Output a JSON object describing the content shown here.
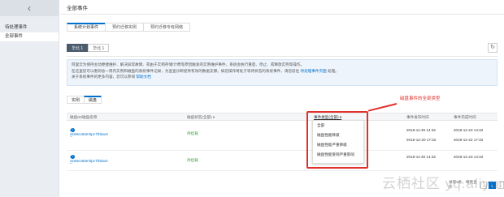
{
  "sidebar": {
    "back_icon": "‹",
    "items": [
      {
        "label": "待处理事件"
      },
      {
        "label": "全部事件"
      }
    ]
  },
  "page": {
    "title": "全部事件"
  },
  "top_tabs": [
    "系统计划事件",
    "预约迁移实例",
    "预约迁移专有网络"
  ],
  "sub_tabs": [
    "华北 1",
    "华北 1"
  ],
  "notice": {
    "line1": "阿里云为保持主动便捷维护、解决异常故障、或由于实例存储/计费等原因触发的实例维护事件，系统会执行重启、停止、或释放实例等操作。",
    "line2_text": "在这里您可以看到总一周内实例和磁盘的系统事件记录，为查查诊断提供有效的数据支撑。如您操作将处于等待状态的系统事件，请您前往",
    "line2_link": "待处理事件页面",
    "line2_tail": "处理。",
    "line3_text": "关于系统事件的更多内容，您可以参阅",
    "line3_link": "帮助文档"
  },
  "resource_tabs": [
    "实例",
    "磁盘"
  ],
  "table": {
    "headers": {
      "name": "磁盘ID/磁盘名称",
      "status": "磁盘状态(全部) ▾",
      "event_type": "事件类型(全部) ▾",
      "publish_time": "事件发布时间",
      "complete_time": "事件完成时间"
    },
    "rows": [
      {
        "id": "d-2ze8co63mlrpc7fnbar3",
        "sub": "--",
        "status": "待挂载",
        "publish1": "2018-11-30 14:32",
        "publish2": "2018-12-20 17:32",
        "complete1": "2018-12-23 14:32",
        "complete2": "2018-12-22 17:32"
      },
      {
        "id": "d-2ze8co63mlrpc7fnbar2",
        "sub": "--",
        "status": "待挂载",
        "publish1": "2018-11-30 14:32",
        "publish2": "",
        "complete1": "2018-12-23 14:32",
        "complete2": ""
      }
    ]
  },
  "event_type_dropdown": {
    "options": [
      "全部",
      "磁盘性能降级",
      "磁盘性能严重降级",
      "磁盘性能受到严重影响"
    ]
  },
  "annotation": {
    "text": "磁盘事件的全部类型"
  },
  "pager": {
    "summary": "共有2条，每页显示",
    "prev": "‹",
    "current": "1",
    "next": "›"
  },
  "watermark": {
    "text": "云栖社区 yq.aliyun.com"
  },
  "colors": {
    "accent": "#0070cc",
    "annotation": "#e0302a",
    "status_ok": "#48a646"
  }
}
